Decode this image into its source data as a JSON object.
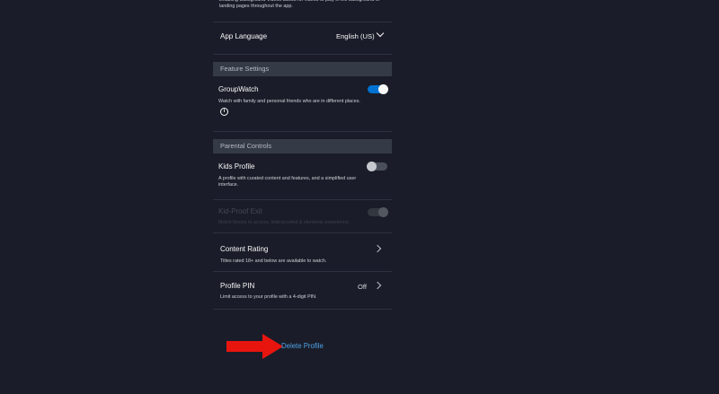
{
  "background_video": {
    "description": "Enabling Background Videos allows for videos to play in the background of landing pages throughout the app."
  },
  "app_language": {
    "label": "App Language",
    "value": "English (US)"
  },
  "feature_settings": {
    "header": "Feature Settings",
    "groupwatch": {
      "label": "GroupWatch",
      "description": "Watch with family and personal friends who are in different places.",
      "enabled": true,
      "info_icon": "info-icon"
    }
  },
  "parental_controls": {
    "header": "Parental Controls",
    "kids_profile": {
      "label": "Kids Profile",
      "description": "A profile with curated content and features, and a simplified user interface.",
      "enabled": false
    },
    "kid_proof_exit": {
      "label": "Kid-Proof Exit",
      "description": "Match blocks to access, kids-proofed & elements experience.",
      "disabled": true
    },
    "content_rating": {
      "label": "Content Rating",
      "description": "Titles rated 18+ and below are available to watch."
    },
    "profile_pin": {
      "label": "Profile PIN",
      "value": "Off",
      "description": "Limit access to your profile with a 4-digit PIN."
    }
  },
  "delete_profile": {
    "label": "Delete Profile"
  },
  "colors": {
    "background": "#1a1d29",
    "section_header": "#353a47",
    "accent": "#0072d2",
    "link": "#4fa3e8",
    "arrow": "#e8150f"
  },
  "annotation": {
    "arrow_icon": "red-arrow-icon"
  }
}
